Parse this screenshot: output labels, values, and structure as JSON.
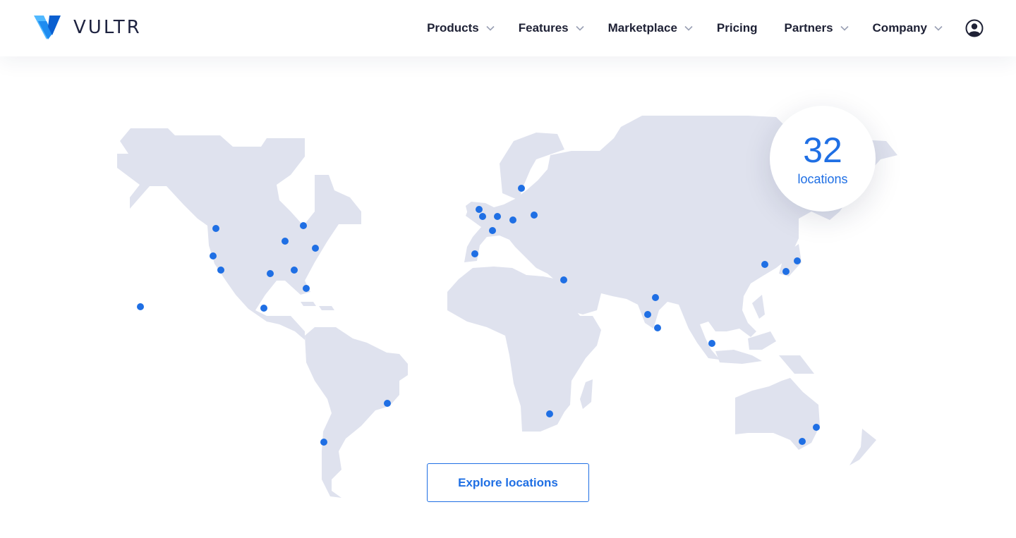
{
  "brand": {
    "name": "VULTR"
  },
  "nav": {
    "items": [
      {
        "label": "Products",
        "has_dropdown": true
      },
      {
        "label": "Features",
        "has_dropdown": true
      },
      {
        "label": "Marketplace",
        "has_dropdown": true
      },
      {
        "label": "Pricing",
        "has_dropdown": false
      },
      {
        "label": "Partners",
        "has_dropdown": true
      },
      {
        "label": "Company",
        "has_dropdown": true
      }
    ],
    "account_icon": "user-circle-icon"
  },
  "locations_badge": {
    "count": "32",
    "label": "locations"
  },
  "cta": {
    "label": "Explore locations"
  },
  "colors": {
    "accent": "#1f6fe4",
    "land": "#dfe2ee",
    "text": "#1e2135"
  }
}
